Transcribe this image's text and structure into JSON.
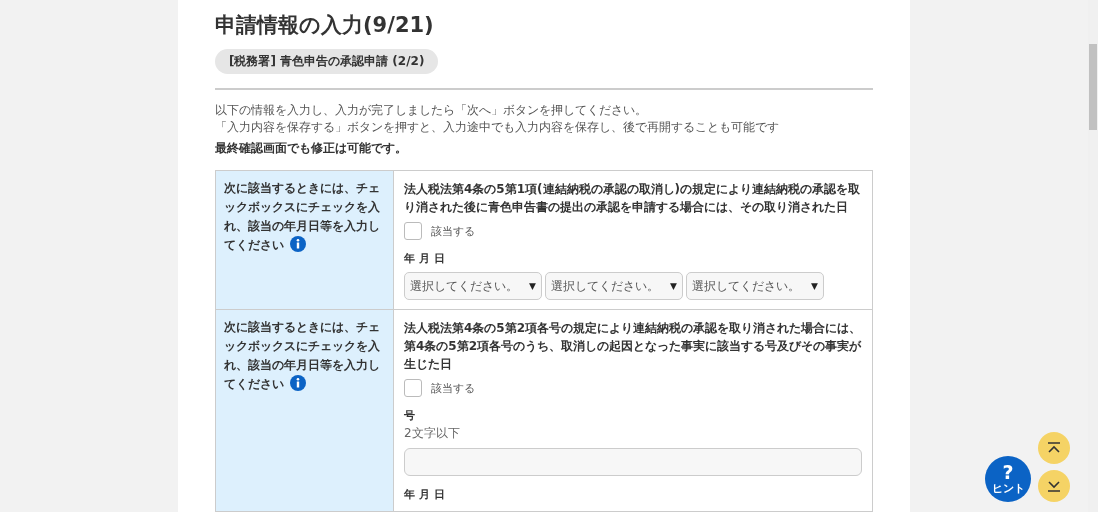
{
  "header": {
    "title": "申請情報の入力(9/21)",
    "section_badge": "[税務署] 青色申告の承認申請 (2/2)"
  },
  "instructions": [
    "以下の情報を入力し、入力が完了しましたら「次へ」ボタンを押してください。",
    "「入力内容を保存する」ボタンを押すと、入力途中でも入力内容を保存し、後で再開することも可能です"
  ],
  "note": "最終確認画面でも修正は可能です。",
  "rows": [
    {
      "prompt": "次に該当するときには、チェックボックスにチェックを入れ、該当の年月日等を入力してください",
      "question": "法人税法第4条の5第1項(連結納税の承認の取消し)の規定により連結納税の承認を取り消された後に青色申告書の提出の承認を申請する場合には、その取り消された日",
      "checkbox": {
        "label": "該当する",
        "checked": false
      },
      "fields": [
        {
          "kind": "date",
          "label": "年 月 日",
          "selects": [
            {
              "placeholder": "選択してください。",
              "caret": "▼"
            },
            {
              "placeholder": "選択してください。",
              "caret": "▼"
            },
            {
              "placeholder": "選択してください。",
              "caret": "▼"
            }
          ]
        }
      ]
    },
    {
      "prompt": "次に該当するときには、チェックボックスにチェックを入れ、該当の年月日等を入力してください",
      "question": "法人税法第4条の5第2項各号の規定により連結納税の承認を取り消された場合には、第4条の5第2項各号のうち、取消しの起因となった事実に該当する号及びその事実が生じた日",
      "checkbox": {
        "label": "該当する",
        "checked": false
      },
      "fields": [
        {
          "kind": "text",
          "label": "号",
          "hint": "2文字以下"
        },
        {
          "kind": "label",
          "label": "年 月 日"
        }
      ]
    }
  ],
  "floating": {
    "hint_button": {
      "symbol": "?",
      "label": "ヒント"
    }
  }
}
